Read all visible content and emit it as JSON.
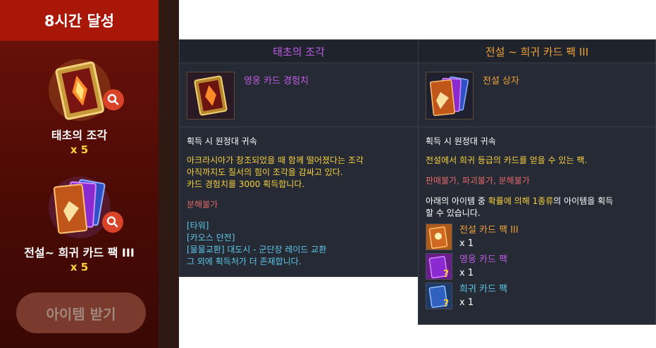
{
  "reward_panel": {
    "title": "8시간 달성",
    "rewards": [
      {
        "name": "태초의 조각",
        "qty": "x 5",
        "icon": "card-fragment-icon"
      },
      {
        "name": "전설~ 희귀 카드 팩 III",
        "qty": "x 5",
        "icon": "card-pack-icon"
      }
    ],
    "claim_button": "아이템 받기"
  },
  "tooltip_fragment": {
    "title": "태초의 조각",
    "item_type": "영웅 카드 경험치",
    "bind": "획득 시 원정대 귀속",
    "desc_lines": [
      "아크라시아가 창조되었을 때 함께 떨어졌다는 조각",
      "아직까지도 질서의 힘이 조각을 감싸고 있다.",
      "카드 경험치를 3000 획득합니다."
    ],
    "restriction": "분해불가",
    "sources": [
      "[타워]",
      "[카오스 던전]",
      "[물물교환] 대도시 - 군단장 레이드 교환",
      "그 외에 획득처가 더 존재합니다."
    ]
  },
  "tooltip_pack": {
    "title": "전설 ~ 희귀 카드 팩 III",
    "item_type": "전설 상자",
    "bind": "획득 시 원정대 귀속",
    "desc": "전설에서 희귀 등급의 카드를 얻을 수 있는 팩.",
    "restrictions": [
      "판매불가",
      "파괴불가",
      "분해불가"
    ],
    "random_line1_a": "아래의 아이템 중 ",
    "random_line1_b": "확률에 의해 1종류",
    "random_line1_c": "의 아이템을 획득",
    "random_line2": "할 수 있습니다.",
    "items": [
      {
        "name": "전설 카드 팩 III",
        "qty": "x 1",
        "color": "#f0a23a"
      },
      {
        "name": "영웅 카드 팩",
        "qty": "x 1",
        "color": "#c05ce6"
      },
      {
        "name": "희귀 카드 팩",
        "qty": "x 1",
        "color": "#5ec8e8"
      }
    ]
  },
  "colors": {
    "legend": "#f0a23a",
    "hero": "#c05ce6",
    "rare": "#5ec8e8",
    "panel_red": "#a81708"
  }
}
